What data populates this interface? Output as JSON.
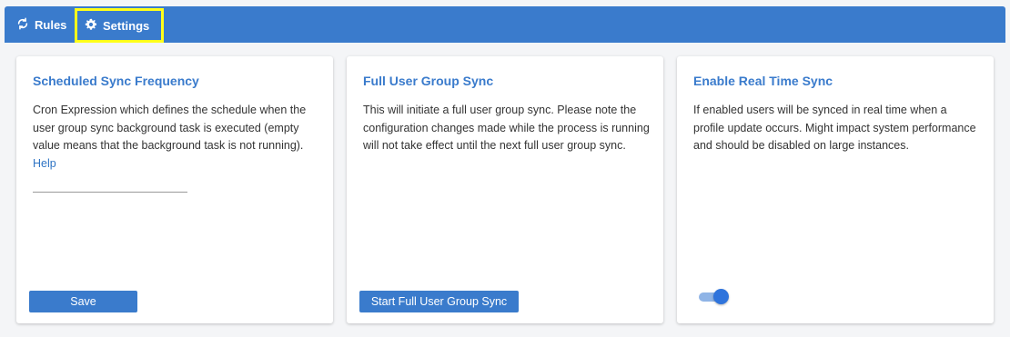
{
  "tabs": {
    "rules_label": "Rules",
    "settings_label": "Settings"
  },
  "panels": {
    "scheduled": {
      "title": "Scheduled Sync Frequency",
      "description": "Cron Expression which defines the schedule when the user group sync background task is executed (empty value means that the background task is not running).",
      "help_link": "Help",
      "cron_value": "",
      "save_label": "Save"
    },
    "full_sync": {
      "title": "Full User Group Sync",
      "description": "This will initiate a full user group sync. Please note the configuration changes made while the process is running will not take effect until the next full user group sync.",
      "button_label": "Start Full User Group Sync"
    },
    "real_time": {
      "title": "Enable Real Time Sync",
      "description": "If enabled users will be synced in real time when a profile update occurs. Might impact system performance and should be disabled on large instances.",
      "enabled": true
    }
  },
  "colors": {
    "accent": "#3a7bcc",
    "highlight": "#ffff1a"
  },
  "icons": {
    "rules": "sync-icon",
    "settings": "gear-icon"
  }
}
